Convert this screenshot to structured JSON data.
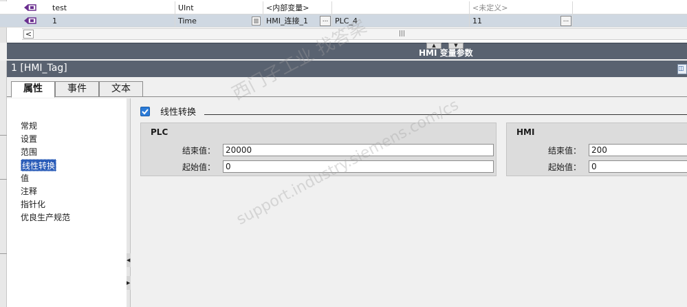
{
  "tag_table": {
    "rows": [
      {
        "name": "test",
        "type": "UInt",
        "connection": "<内部变量>",
        "plc_name": "",
        "address": "<未定义>"
      },
      {
        "name": "1",
        "type": "Time",
        "connection": "HMI_连接_1",
        "plc_name": "PLC_4",
        "address": "11"
      }
    ],
    "scroll_left": "<",
    "scroll_grip": "|||"
  },
  "split_bar": {
    "title": "HMI 变量参数"
  },
  "inspector": {
    "title": "1 [HMI_Tag]"
  },
  "tabs": [
    {
      "label": "属性",
      "active": true
    },
    {
      "label": "事件",
      "active": false
    },
    {
      "label": "文本",
      "active": false
    }
  ],
  "nav": {
    "items": [
      "常规",
      "设置",
      "范围",
      "线性转换",
      "值",
      "注释",
      "指针化",
      "优良生产规范"
    ],
    "selected": "线性转换"
  },
  "linear": {
    "title": "线性转换",
    "checked": true,
    "plc": {
      "title": "PLC",
      "end_label": "结束值：",
      "end_value": "20000",
      "start_label": "起始值：",
      "start_value": "0"
    },
    "hmi": {
      "title": "HMI",
      "end_label": "结束值：",
      "end_value": "200",
      "start_label": "起始值：",
      "start_value": "0"
    }
  },
  "watermark": {
    "line1": "西门子工业  找答案",
    "line2": "support.industry.siemens.com/cs"
  },
  "colors": {
    "header_bg": "#596270",
    "selection": "#2a5cb8",
    "checkbox": "#2b7bd8"
  }
}
